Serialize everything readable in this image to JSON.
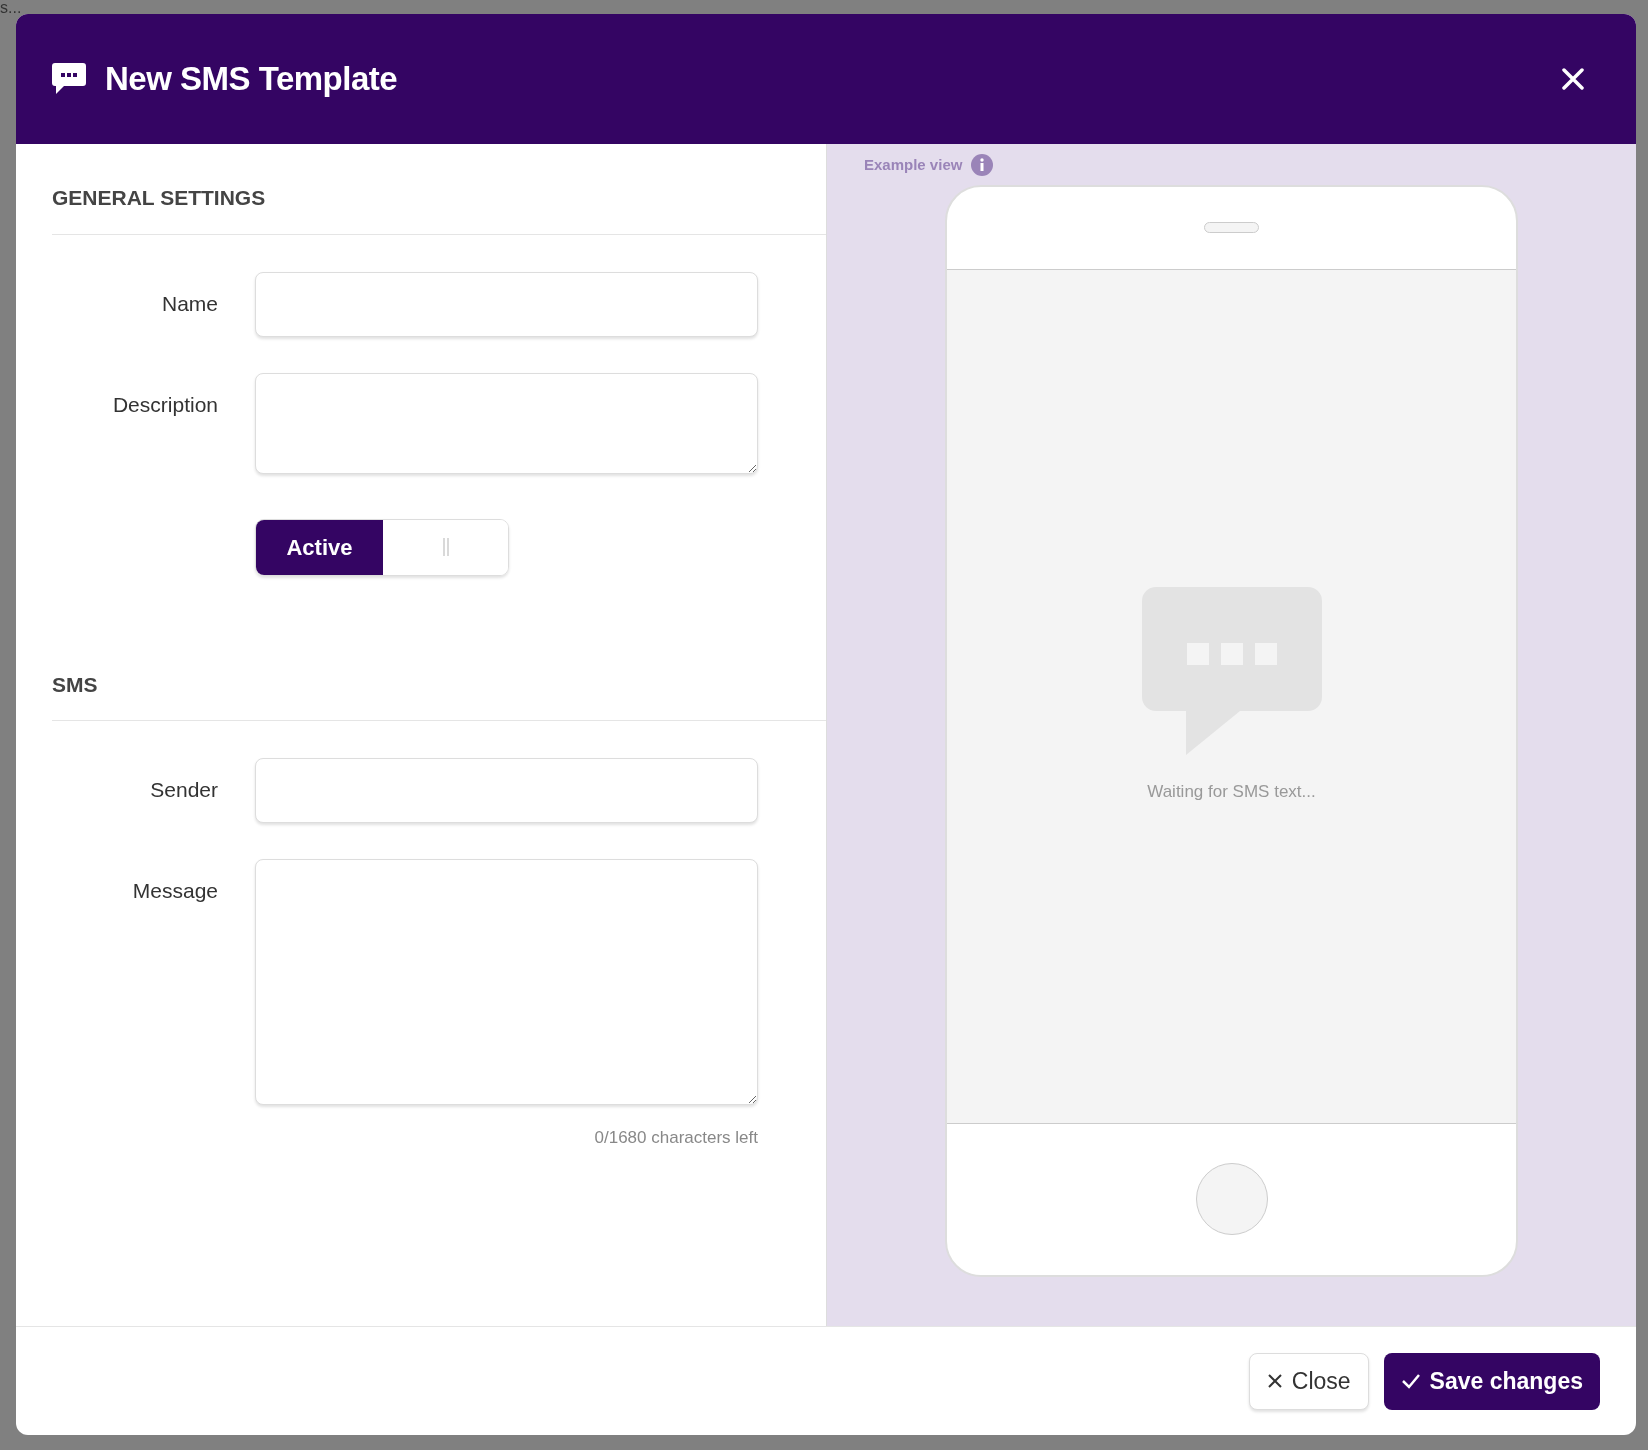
{
  "background": {
    "top_text": "s..."
  },
  "dialog": {
    "title": "New SMS Template"
  },
  "general_settings": {
    "heading": "GENERAL SETTINGS",
    "fields": [
      {
        "label": "Name",
        "kind": "input"
      },
      {
        "label": "Description",
        "kind": "textarea"
      }
    ],
    "toggle": {
      "label": "Active",
      "on": true
    }
  },
  "sms": {
    "heading": "SMS",
    "fields": [
      {
        "label": "Sender",
        "kind": "input"
      },
      {
        "label": "Message",
        "kind": "textarea"
      }
    ],
    "counter": "0/1680 characters left"
  },
  "preview": {
    "label": "Example view",
    "placeholder": "Waiting for SMS text..."
  },
  "buttons": [
    {
      "label": "Close",
      "kind": "secondary"
    },
    {
      "label": "Save changes",
      "kind": "primary"
    }
  ]
}
